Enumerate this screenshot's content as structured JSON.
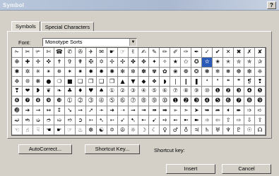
{
  "window": {
    "title": "Symbol",
    "help_label": "?"
  },
  "tabs": [
    {
      "label": "Symbols"
    },
    {
      "label": "Special Characters"
    }
  ],
  "font": {
    "label": "Font:",
    "value": "Monotype Sorts"
  },
  "symbols": [
    [
      "✁",
      "✂",
      "✃",
      "✄",
      "☎",
      "✆",
      "✇",
      "✈",
      "✉",
      "☛",
      "☞",
      "✌",
      "✍",
      "✎",
      "✏",
      "✐",
      "✑",
      "✒",
      "✓",
      "✔",
      "✕",
      "✖",
      "✗",
      "✘"
    ],
    [
      "✙",
      "✚",
      "✛",
      "✜",
      "✝",
      "✞",
      "✟",
      "✠",
      "✡",
      "✢",
      "✣",
      "✤",
      "✥",
      "✦",
      "✧",
      "★",
      "✩",
      "✪",
      "✫",
      "✬",
      "✭",
      "✮",
      "✯",
      "✰"
    ],
    [
      "✱",
      "✲",
      "✳",
      "✴",
      "✵",
      "✶",
      "✷",
      "✸",
      "✹",
      "✺",
      "✻",
      "✼",
      "✽",
      "✾",
      "✿",
      "❀",
      "❁",
      "❂",
      "❃",
      "❄",
      "❅",
      "❆",
      "❇",
      "❈"
    ],
    [
      "❉",
      "❊",
      "❋",
      "●",
      "❍",
      "■",
      "❏",
      "❐",
      "❑",
      "❒",
      "▲",
      "▼",
      "◆",
      "❖",
      "◗",
      "❘",
      "❙",
      "❚",
      "❛",
      "❜",
      "❝",
      "❞",
      "❡",
      "❢"
    ],
    [
      "❣",
      "❤",
      "❥",
      "❦",
      "❧",
      "♣",
      "♦",
      "♥",
      "♠",
      "①",
      "②",
      "③",
      "④",
      "⑤",
      "⑥",
      "⑦",
      "⑧",
      "⑨",
      "⑩",
      "❶",
      "❷",
      "❸",
      "❹",
      "❺"
    ],
    [
      "❻",
      "❼",
      "❽",
      "❾",
      "❿",
      "➀",
      "➁",
      "➂",
      "➃",
      "➄",
      "➅",
      "➆",
      "➇",
      "➈",
      "➉",
      "➊",
      "➋",
      "➌",
      "➍",
      "➎",
      "➏",
      "➐",
      "➑",
      "➒"
    ],
    [
      "➓",
      "➔",
      "→",
      "↔",
      "↕",
      "➘",
      "➙",
      "➚",
      "➛",
      "➜",
      "➝",
      "➞",
      "➟",
      "➠",
      "➡",
      "➢",
      "➣",
      "➤",
      "➥",
      "➦",
      "➧",
      "➨",
      "➩",
      "➪"
    ],
    [
      "➫",
      "➬",
      "➭",
      "➮",
      "➯",
      "➱",
      "➲",
      "➳",
      "➴",
      "➵",
      "➶",
      "➷",
      "➸",
      "➹",
      "➺",
      "➻",
      "➼",
      "➽",
      "➾",
      "⇦",
      "⇧",
      "⇨",
      "⇩",
      "⇪"
    ],
    [
      "☜",
      "☝",
      "☟",
      "☚",
      "☛",
      "☞",
      "♨",
      "☸",
      "☯",
      "✡",
      "☮",
      "☼",
      "☽",
      "☾",
      "♀",
      "♂",
      "♁",
      "♃",
      "♄",
      "♅",
      "♆",
      "♇",
      "☉",
      "☊"
    ]
  ],
  "selected_cell": {
    "row": 1,
    "col": 18
  },
  "buttons": {
    "autocorrect": "AutoCorrect...",
    "shortcut_key": "Shortcut Key...",
    "insert": "Insert",
    "cancel": "Cancel"
  },
  "shortcut_key_label": "Shortcut key:"
}
